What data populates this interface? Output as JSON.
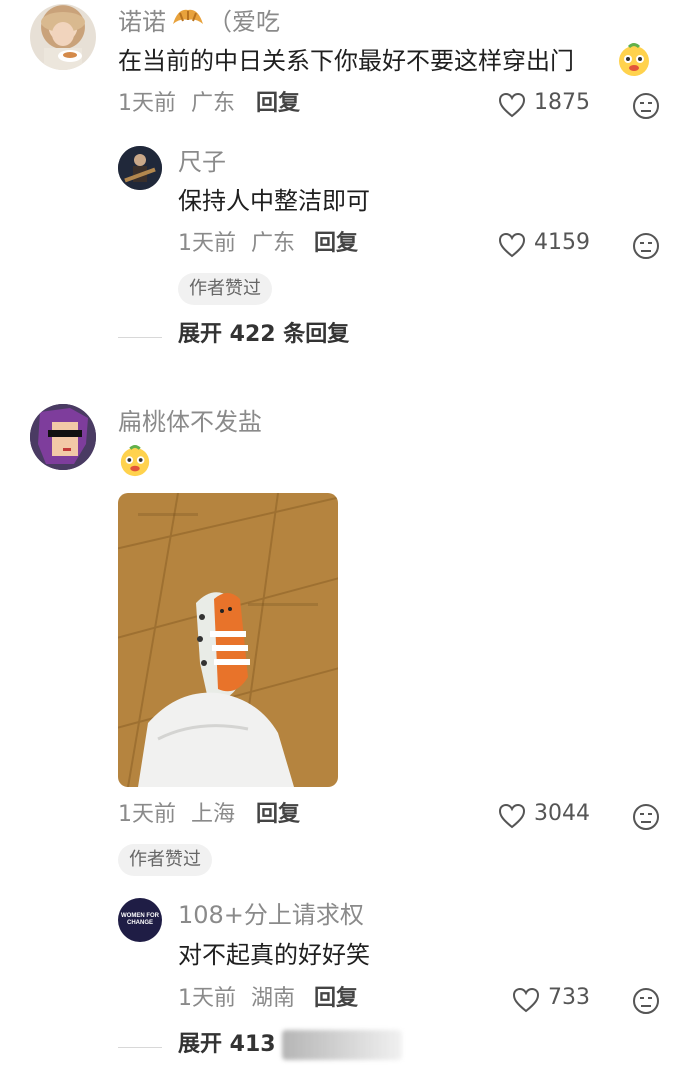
{
  "comments": [
    {
      "username": "诺诺",
      "username_suffix": "（爱吃",
      "text": "在当前的中日关系下你最好不要这样穿出门",
      "time": "1天前",
      "location": "广东",
      "reply_label": "回复",
      "likes": "1875",
      "replies": [
        {
          "username": "尺子",
          "text": "保持人中整洁即可",
          "time": "1天前",
          "location": "广东",
          "reply_label": "回复",
          "likes": "4159",
          "badge": "作者赞过"
        }
      ],
      "expand_label": "展开 422 条回复"
    },
    {
      "username": "扁桃体不发盐",
      "time": "1天前",
      "location": "上海",
      "reply_label": "回复",
      "likes": "3044",
      "badge": "作者赞过",
      "replies": [
        {
          "username": "108+分上请求权",
          "avatar_text": "WOMEN FOR CHANGE",
          "text": "对不起真的好好笑",
          "time": "1天前",
          "location": "湖南",
          "reply_label": "回复",
          "likes": "733"
        }
      ],
      "expand_label": "展开 413"
    }
  ],
  "colors": {
    "text_primary": "#1f1f1f",
    "text_secondary": "#8a8a8a",
    "badge_bg": "#f1f1f1",
    "floor_wood": "#b5843f",
    "sock_orange": "#e8732a"
  },
  "icons": [
    "heart-icon",
    "dislike-face-icon",
    "croissant-icon",
    "smile-emoji-icon"
  ]
}
